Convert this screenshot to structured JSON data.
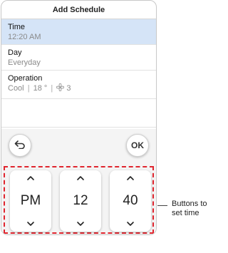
{
  "header": {
    "title": "Add Schedule"
  },
  "rows": {
    "time": {
      "title": "Time",
      "value": "12:20 AM"
    },
    "day": {
      "title": "Day",
      "value": "Everyday"
    },
    "operation": {
      "title": "Operation",
      "mode": "Cool",
      "temp": "18 °",
      "fan": "3"
    }
  },
  "buttons": {
    "back_icon": "return-arrow-icon",
    "ok_label": "OK"
  },
  "picker": {
    "ampm": "PM",
    "hour": "12",
    "minute": "40"
  },
  "callout": {
    "line1": "Buttons to",
    "line2": "set time"
  },
  "colors": {
    "selected_row": "#d5e4f7",
    "dash_border": "#e0252e"
  }
}
